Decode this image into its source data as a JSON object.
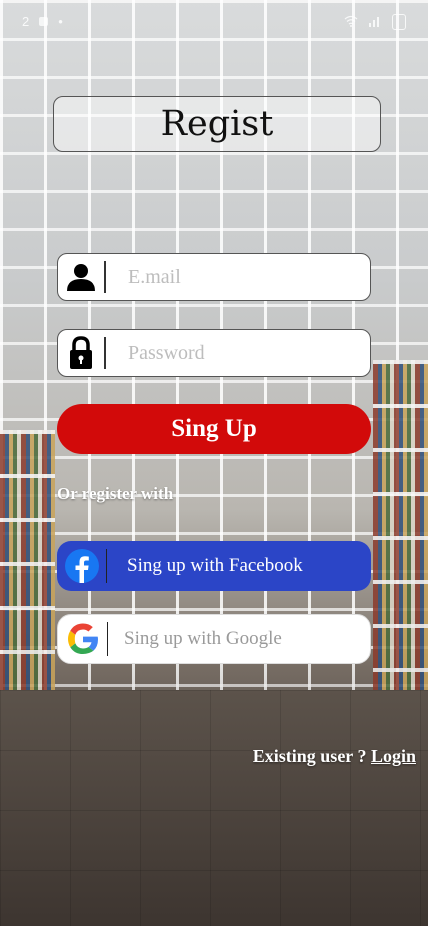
{
  "status_bar": {
    "time": "2",
    "left_glyph": "•"
  },
  "title": "Regist",
  "email": {
    "placeholder": "E.mail",
    "value": ""
  },
  "password": {
    "placeholder": "Password",
    "value": ""
  },
  "signup_button": "Sing Up",
  "or_register_with": "Or register with",
  "facebook_button": "Sing up with Facebook",
  "google_button": "Sing up with Google",
  "existing_user": "Existing user ? ",
  "login_link": "Login",
  "colors": {
    "primary": "#d20a0a",
    "facebook": "#2b45c7"
  },
  "icons": {
    "email": "user-icon",
    "password": "lock-icon",
    "facebook": "facebook-icon",
    "google": "google-icon"
  }
}
